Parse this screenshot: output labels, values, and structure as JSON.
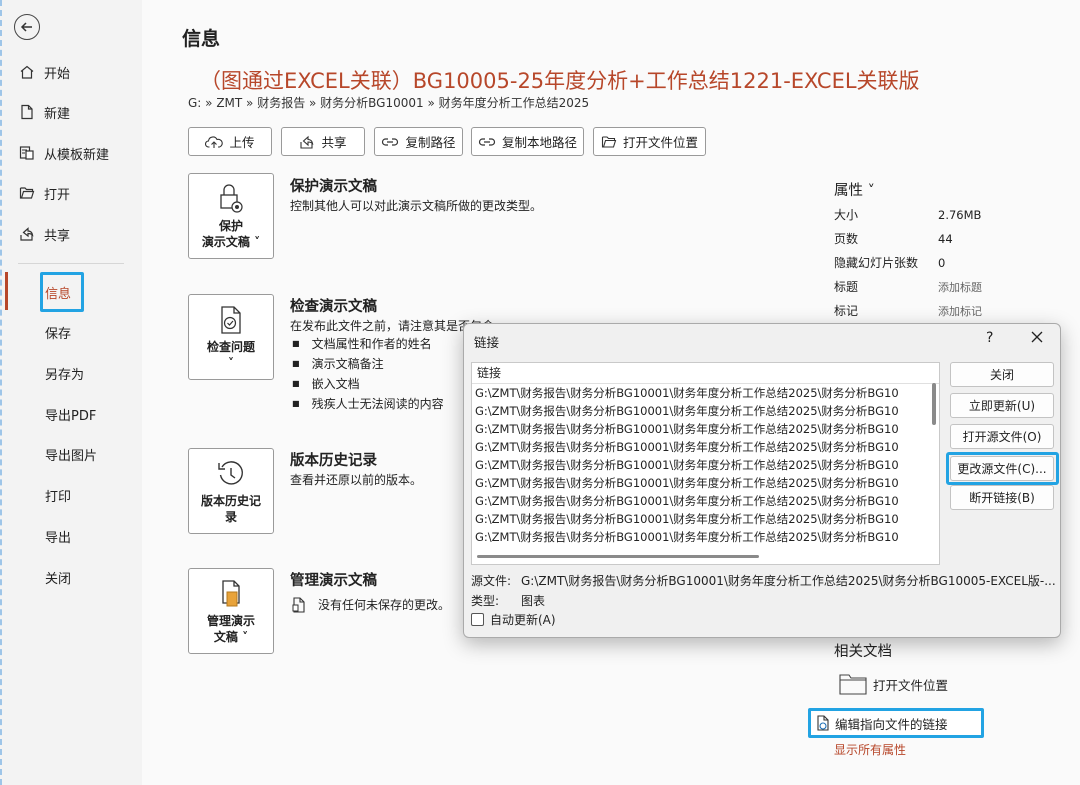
{
  "sidebar": {
    "items": [
      {
        "label": "开始",
        "icon": "home-icon"
      },
      {
        "label": "新建",
        "icon": "new-document-icon"
      },
      {
        "label": "从模板新建",
        "icon": "template-icon"
      },
      {
        "label": "打开",
        "icon": "folder-open-icon"
      },
      {
        "label": "共享",
        "icon": "share-icon"
      }
    ],
    "plain_items": [
      "信息",
      "保存",
      "另存为",
      "导出PDF",
      "导出图片",
      "打印",
      "导出",
      "关闭"
    ],
    "active": "信息"
  },
  "main": {
    "heading": "信息",
    "doc_title": "（图通过EXCEL关联）BG10005-25年度分析+工作总结1221-EXCEL关联版",
    "breadcrumb": "G: » ZMT » 财务报告 » 财务分析BG10001 » 财务年度分析工作总结2025",
    "actions": [
      "上传",
      "共享",
      "复制路径",
      "复制本地路径",
      "打开文件位置"
    ],
    "sections": {
      "protect": {
        "tile_line1": "保护",
        "tile_line2": "演示文稿 ˅",
        "title": "保护演示文稿",
        "desc": "控制其他人可以对此演示文稿所做的更改类型。"
      },
      "inspect": {
        "tile_line1": "检查问题",
        "tile_line2": "˅",
        "title": "检查演示文稿",
        "desc": "在发布此文件之前，请注意其是否包含:",
        "bullets": [
          "文档属性和作者的姓名",
          "演示文稿备注",
          "嵌入文档",
          "残疾人士无法阅读的内容"
        ]
      },
      "history": {
        "tile_line1": "版本历史记",
        "tile_line2": "录",
        "title": "版本历史记录",
        "desc": "查看并还原以前的版本。"
      },
      "manage": {
        "tile_line1": "管理演示",
        "tile_line2": "文稿 ˅",
        "title": "管理演示文稿",
        "desc": "没有任何未保存的更改。"
      }
    }
  },
  "properties": {
    "header": "属性 ˅",
    "rows": [
      {
        "k": "大小",
        "v": "2.76MB"
      },
      {
        "k": "页数",
        "v": "44"
      },
      {
        "k": "隐藏幻灯片张数",
        "v": "0"
      },
      {
        "k": "标题",
        "v": "添加标题"
      },
      {
        "k": "标记",
        "v": "添加标记"
      }
    ],
    "related_title": "相关文档",
    "related_open": "打开文件位置",
    "edit_links": "编辑指向文件的链接",
    "show_all": "显示所有属性"
  },
  "dialog": {
    "title": "链接",
    "help": "?",
    "list_header": "链接",
    "rows": [
      "G:\\ZMT\\财务报告\\财务分析BG10001\\财务年度分析工作总结2025\\财务分析BG10",
      "G:\\ZMT\\财务报告\\财务分析BG10001\\财务年度分析工作总结2025\\财务分析BG10",
      "G:\\ZMT\\财务报告\\财务分析BG10001\\财务年度分析工作总结2025\\财务分析BG10",
      "G:\\ZMT\\财务报告\\财务分析BG10001\\财务年度分析工作总结2025\\财务分析BG10",
      "G:\\ZMT\\财务报告\\财务分析BG10001\\财务年度分析工作总结2025\\财务分析BG10",
      "G:\\ZMT\\财务报告\\财务分析BG10001\\财务年度分析工作总结2025\\财务分析BG10",
      "G:\\ZMT\\财务报告\\财务分析BG10001\\财务年度分析工作总结2025\\财务分析BG10",
      "G:\\ZMT\\财务报告\\财务分析BG10001\\财务年度分析工作总结2025\\财务分析BG10",
      "G:\\ZMT\\财务报告\\财务分析BG10001\\财务年度分析工作总结2025\\财务分析BG10"
    ],
    "buttons": [
      "关闭",
      "立即更新(U)",
      "打开源文件(O)",
      "更改源文件(C)...",
      "断开链接(B)"
    ],
    "source_label": "源文件:",
    "source_value": "G:\\ZMT\\财务报告\\财务分析BG10001\\财务年度分析工作总结2025\\财务分析BG10005-EXCEL版-...",
    "type_label": "类型:",
    "type_value": "图表",
    "auto_update_label": "自动更新(A)",
    "auto_update_checked": false
  },
  "colors": {
    "accent": "#b7472a",
    "highlight": "#22a3e3"
  }
}
